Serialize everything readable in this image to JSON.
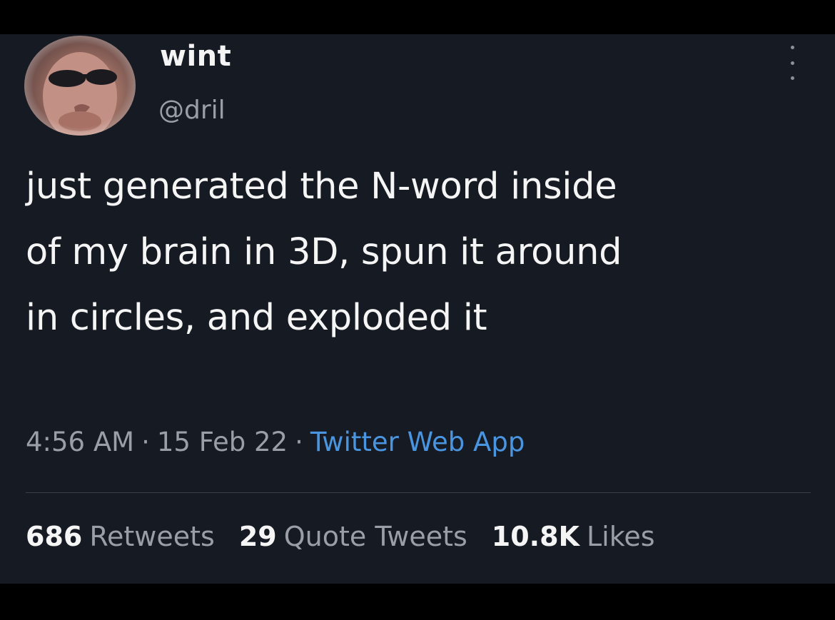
{
  "author": {
    "display_name": "wint",
    "handle": "@dril"
  },
  "tweet": {
    "lines": [
      "just generated the N-word inside",
      "of my brain in 3D, spun it around",
      "in circles, and exploded it"
    ],
    "time": "4:56 AM",
    "date": "15 Feb 22",
    "separator": "·",
    "source": "Twitter Web App"
  },
  "stats": {
    "retweets_count": "686",
    "retweets_label": "Retweets",
    "quotes_count": "29",
    "quotes_label": "Quote Tweets",
    "likes_count": "10.8K",
    "likes_label": "Likes"
  },
  "colors": {
    "background": "#161a23",
    "link": "#4a95e0",
    "muted": "#9a9ea6",
    "text": "#f5f5f5"
  },
  "icons": {
    "more": "more-vertical-icon"
  }
}
